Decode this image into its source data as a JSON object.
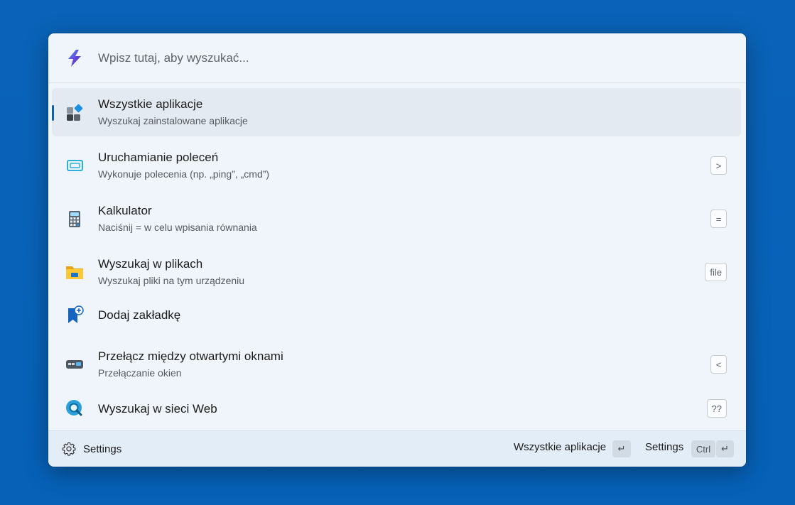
{
  "search": {
    "placeholder": "Wpisz tutaj, aby wyszukać..."
  },
  "results": [
    {
      "title": "Wszystkie aplikacje",
      "subtitle": "Wyszukaj zainstalowane aplikacje",
      "shortcut": "",
      "icon": "all-apps-icon",
      "selected": true
    },
    {
      "title": "Uruchamianie poleceń",
      "subtitle": "Wykonuje polecenia (np. „ping”, „cmd”)",
      "shortcut": ">",
      "icon": "terminal-icon"
    },
    {
      "title": "Kalkulator",
      "subtitle": "Naciśnij = w celu wpisania równania",
      "shortcut": "=",
      "icon": "calculator-icon"
    },
    {
      "title": "Wyszukaj w plikach",
      "subtitle": "Wyszukaj pliki na tym urządzeniu",
      "shortcut": "file",
      "icon": "folder-icon"
    },
    {
      "title": "Dodaj zakładkę",
      "subtitle": "",
      "shortcut": "",
      "icon": "bookmark-add-icon"
    },
    {
      "title": "Przełącz między otwartymi oknami",
      "subtitle": "Przełączanie okien",
      "shortcut": "<",
      "icon": "window-switch-icon"
    },
    {
      "title": "Wyszukaj w sieci Web",
      "subtitle": "",
      "shortcut": "??",
      "icon": "web-search-icon"
    }
  ],
  "footer": {
    "settings_label": "Settings",
    "primary_action": "Wszystkie aplikacje",
    "primary_key": "↵",
    "secondary_action": "Settings",
    "secondary_key_mod": "Ctrl",
    "secondary_key": "↵"
  },
  "colors": {
    "background": "#0661b7",
    "accent": "#0a5fb4",
    "selected_row": "#e4eaf1"
  }
}
